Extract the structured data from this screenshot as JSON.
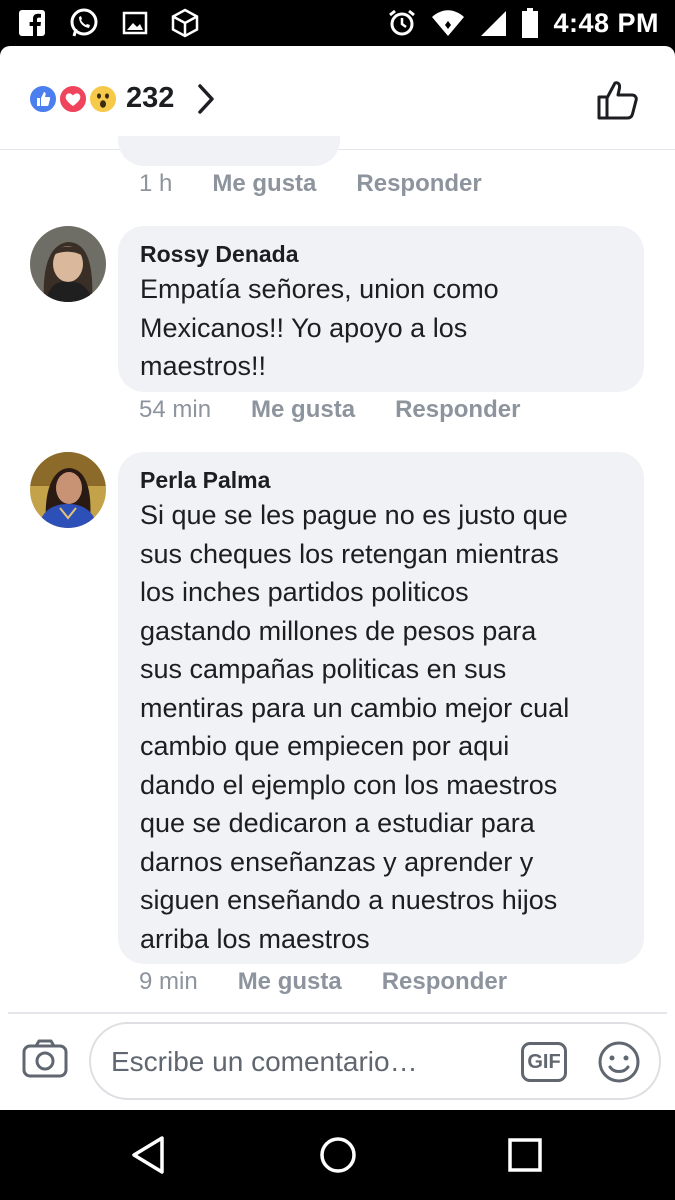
{
  "status_bar": {
    "time": "4:48 PM",
    "left_icons": [
      "facebook-icon",
      "whatsapp-icon",
      "gallery-icon",
      "cube-app-icon"
    ],
    "right_icons": [
      "alarm-icon",
      "wifi-icon",
      "signal-icon",
      "battery-icon"
    ]
  },
  "reactions": {
    "types": [
      "like",
      "love",
      "wow"
    ],
    "count": "232"
  },
  "previous_comment": {
    "time": "1 h",
    "like_label": "Me gusta",
    "reply_label": "Responder"
  },
  "comments": [
    {
      "author": "Rossy Denada",
      "text": "Empatía señores, union como\nMexicanos!! Yo apoyo a los\nmaestros!!",
      "time": "54 min",
      "like_label": "Me gusta",
      "reply_label": "Responder"
    },
    {
      "author": "Perla Palma",
      "text": "Si que se les pague no es justo que\nsus cheques los retengan mientras\nlos inches partidos politicos\ngastando millones de pesos para\nsus campañas politicas en sus\nmentiras para un cambio mejor cual\ncambio que empiecen por aqui\ndando el ejemplo con los maestros\nque se dedicaron a estudiar para\ndarnos enseñanzas y aprender y\nsiguen enseñando a nuestros hijos\narriba los maestros",
      "time": "9 min",
      "like_label": "Me gusta",
      "reply_label": "Responder"
    }
  ],
  "composer": {
    "placeholder": "Escribe un comentario…",
    "gif_label": "GIF"
  },
  "colors": {
    "like_blue": "#4b7ff0",
    "love_red": "#f0435c",
    "wow_yellow": "#f7c94a",
    "bubble_bg": "#f0f2f5",
    "meta_gray": "#8d949e"
  }
}
